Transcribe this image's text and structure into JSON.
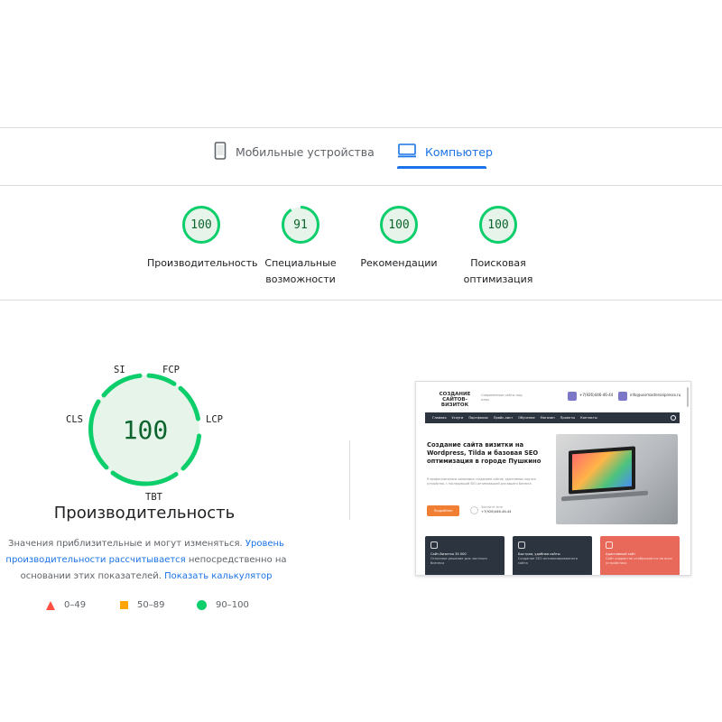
{
  "tabs": [
    {
      "label": "Мобильные устройства",
      "icon": "smartphone-icon",
      "active": false
    },
    {
      "label": "Компьютер",
      "icon": "desktop-icon",
      "active": true
    }
  ],
  "categories": [
    {
      "score": "100",
      "label_lines": [
        "Производительность"
      ]
    },
    {
      "score": "91",
      "label_lines": [
        "Специальные",
        "возможности"
      ]
    },
    {
      "score": "100",
      "label_lines": [
        "Рекомендации"
      ]
    },
    {
      "score": "100",
      "label_lines": [
        "Поисковая",
        "оптимизация"
      ]
    }
  ],
  "performance": {
    "score": "100",
    "title": "Производительность",
    "metrics": {
      "si": "SI",
      "fcp": "FCP",
      "lcp": "LCP",
      "tbt": "TBT",
      "cls": "CLS"
    },
    "description_prefix": "Значения приблизительные и могут изменяться.",
    "description_link1": "Уровень производительности рассчитывается",
    "description_middle": "непосредственно на основании этих показателей.",
    "description_link2": "Показать калькулятор"
  },
  "legend": [
    {
      "shape": "triangle",
      "color": "#ff4e42",
      "label": "0–49"
    },
    {
      "shape": "square",
      "color": "#ffa400",
      "label": "50–89"
    },
    {
      "shape": "circle",
      "color": "#0cce6b",
      "label": "90–100"
    }
  ],
  "colors": {
    "pass": "#0cce6b",
    "pass_fill": "#e6f4ea",
    "pass_text": "#0d652d",
    "accent": "#1a73e8"
  },
  "screenshot": {
    "logo": "СОЗДАНИЕ САЙТОВ-ВИЗИТОК",
    "tagline": "Современные сайты под ключ",
    "phone": "+7(926)446-46-44",
    "email": "info@ussmasterseipresss.ru",
    "nav": [
      "Главная",
      "Услуги",
      "Портфолио",
      "Прайс-лист",
      "Обучение",
      "Магазин",
      "Проекты",
      "Контакты"
    ],
    "hero_title": "Создание сайта визитки на Wordpress, Tilda и базовая SEO оптимизация в городе Пушкино",
    "hero_text": "Я профессионально занимаюсь созданием сайтов, адаптивных под все устройства, с последующей SEO-оптимизацией для вашего бизнеса",
    "button": "Подробнее",
    "phone_caption": "Звоните мне",
    "hero_phone": "+7(926)446-46-44",
    "cards": [
      {
        "title": "Сайт-Визитка 35 000",
        "text": "Отличное решение для частного бизнеса",
        "color": "#2c3440"
      },
      {
        "title": "Быстрая, удобная сайты",
        "text": "Создание SEO оптимизированного сайта",
        "color": "#2c3440"
      },
      {
        "title": "Адаптивный сайт",
        "text": "Сайт корректно отображается на всех устройствах",
        "color": "#e8685a"
      }
    ]
  }
}
